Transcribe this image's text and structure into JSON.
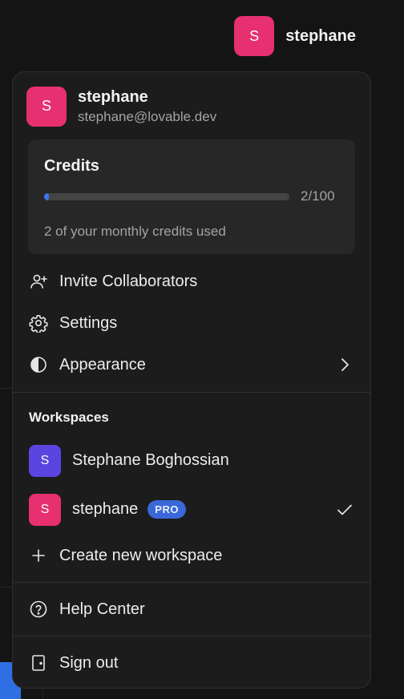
{
  "trigger": {
    "initial": "S",
    "name": "stephane"
  },
  "profile": {
    "initial": "S",
    "name": "stephane",
    "email": "stephane@lovable.dev"
  },
  "credits": {
    "title": "Credits",
    "used": 2,
    "total": 100,
    "count_text": "2/100",
    "note": "2 of your monthly credits used"
  },
  "menu": {
    "invite": "Invite Collaborators",
    "settings": "Settings",
    "appearance": "Appearance"
  },
  "workspaces": {
    "title": "Workspaces",
    "items": [
      {
        "initial": "S",
        "name": "Stephane Boghossian",
        "color": "#5b45e0"
      },
      {
        "initial": "S",
        "name": "stephane",
        "badge": "PRO",
        "color": "#e6306f",
        "selected": true
      }
    ],
    "create": "Create new workspace"
  },
  "footer": {
    "help": "Help Center",
    "signout": "Sign out"
  },
  "colors": {
    "accent": "#3b74f0",
    "avatar_pink": "#e6306f",
    "avatar_purple": "#5b45e0"
  }
}
